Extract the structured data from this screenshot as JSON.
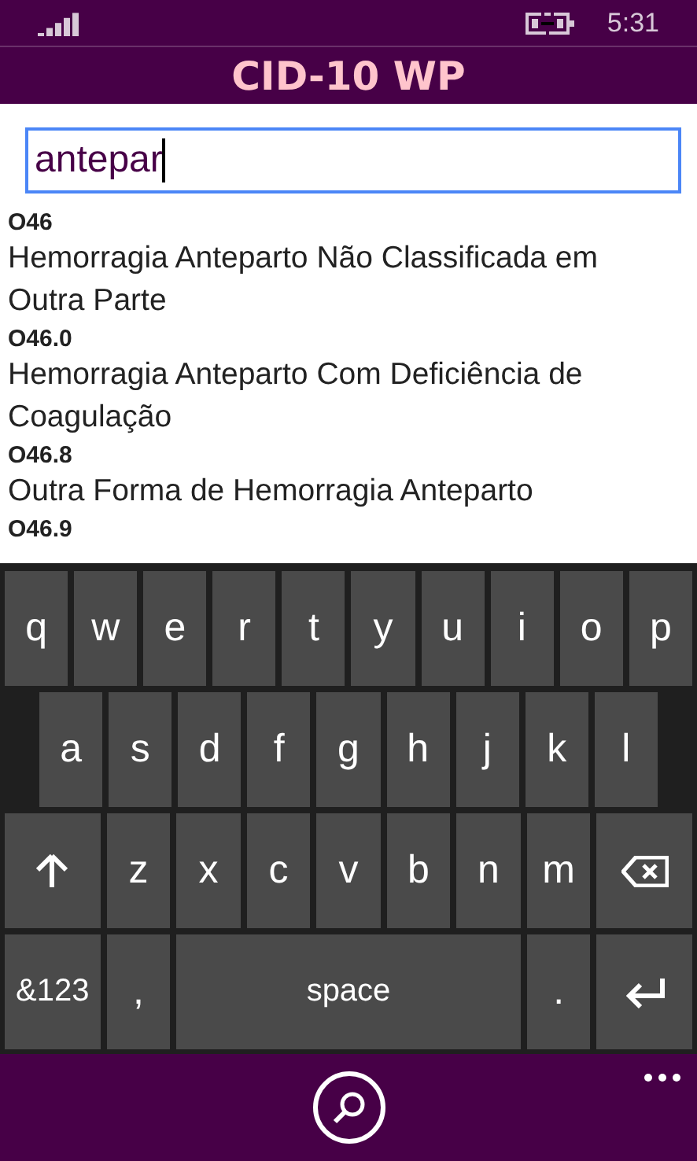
{
  "status_bar": {
    "time": "5:31"
  },
  "title": "CID-10 WP",
  "search": {
    "value": "antepar",
    "focused": true
  },
  "results": [
    {
      "code": "O46",
      "description": "Hemorragia Anteparto Não Classificada em Outra Parte"
    },
    {
      "code": "O46.0",
      "description": "Hemorragia Anteparto Com Deficiência de Coagulação"
    },
    {
      "code": "O46.8",
      "description": "Outra Forma de Hemorragia Anteparto"
    },
    {
      "code": "O46.9"
    }
  ],
  "keyboard": [
    [
      {
        "kind": "letter",
        "label": "q"
      },
      {
        "kind": "letter",
        "label": "w"
      },
      {
        "kind": "letter",
        "label": "e"
      },
      {
        "kind": "letter",
        "label": "r"
      },
      {
        "kind": "letter",
        "label": "t"
      },
      {
        "kind": "letter",
        "label": "y"
      },
      {
        "kind": "letter",
        "label": "u"
      },
      {
        "kind": "letter",
        "label": "i"
      },
      {
        "kind": "letter",
        "label": "o"
      },
      {
        "kind": "letter",
        "label": "p"
      }
    ],
    [
      {
        "kind": "letter",
        "label": "a"
      },
      {
        "kind": "letter",
        "label": "s"
      },
      {
        "kind": "letter",
        "label": "d"
      },
      {
        "kind": "letter",
        "label": "f"
      },
      {
        "kind": "letter",
        "label": "g"
      },
      {
        "kind": "letter",
        "label": "h"
      },
      {
        "kind": "letter",
        "label": "j"
      },
      {
        "kind": "letter",
        "label": "k"
      },
      {
        "kind": "letter",
        "label": "l"
      }
    ],
    [
      {
        "kind": "shift"
      },
      {
        "kind": "letter",
        "label": "z"
      },
      {
        "kind": "letter",
        "label": "x"
      },
      {
        "kind": "letter",
        "label": "c"
      },
      {
        "kind": "letter",
        "label": "v"
      },
      {
        "kind": "letter",
        "label": "b"
      },
      {
        "kind": "letter",
        "label": "n"
      },
      {
        "kind": "letter",
        "label": "m"
      },
      {
        "kind": "backspace"
      }
    ],
    [
      {
        "kind": "symbols",
        "label": "&123"
      },
      {
        "kind": "comma",
        "label": ","
      },
      {
        "kind": "space",
        "label": "space"
      },
      {
        "kind": "period",
        "label": "."
      },
      {
        "kind": "enter"
      }
    ]
  ]
}
